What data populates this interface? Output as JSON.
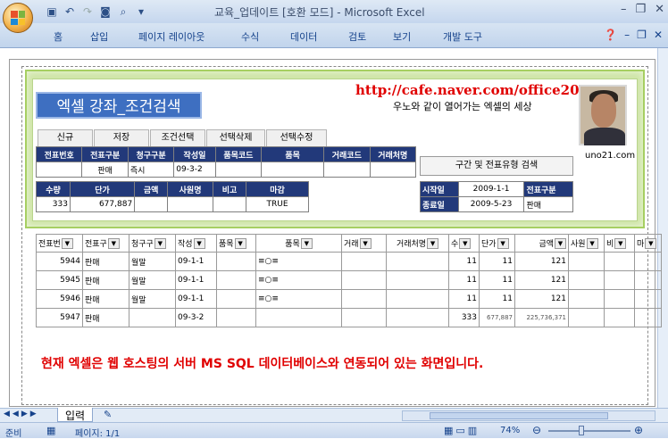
{
  "window": {
    "title": "교육_업데이트 [호환 모드] - Microsoft Excel"
  },
  "ribbon": {
    "tabs": [
      "홈",
      "삽입",
      "페이지 레이아웃",
      "수식",
      "데이터",
      "검토",
      "보기",
      "개발 도구"
    ]
  },
  "form": {
    "title": "엑셀 강좌_조건검색",
    "url": "http://cafe.naver.com/office2080",
    "slogan": "우노와 같이 열어가는 엑셀의 세상",
    "email": "uno21.com",
    "buttons": [
      "신규",
      "저장",
      "조건선택",
      "선택삭제",
      "선택수정"
    ],
    "row1_headers": [
      "전표번호",
      "전표구분",
      "청구구분",
      "작성일",
      "품목코드",
      "품목",
      "거래코드",
      "거래처명"
    ],
    "row1_values": [
      "",
      "판매",
      "즉시",
      "09-3-2",
      "",
      "",
      "",
      ""
    ],
    "row2_headers": [
      "수량",
      "단가",
      "금액",
      "사원명",
      "비고",
      "마감"
    ],
    "row2_values": [
      "333",
      "677,887",
      "",
      "",
      "",
      "TRUE"
    ],
    "search_label": "구간 및 전표유형 검색",
    "start_label": "시작일",
    "start_value": "2009-1-1",
    "end_label": "종료일",
    "end_value": "2009-5-23",
    "type_label": "전표구분",
    "type_value": "판매"
  },
  "table": {
    "headers": [
      "전표번",
      "전표구",
      "청구구",
      "작성",
      "품목",
      "품목",
      "거래",
      "거래처명",
      "수",
      "단가",
      "금액",
      "사원",
      "비",
      "마"
    ],
    "rows": [
      [
        "5944",
        "판매",
        "월말",
        "09-1-1",
        "",
        "≡○≡",
        "",
        "",
        "11",
        "11",
        "121",
        "",
        "",
        ""
      ],
      [
        "5945",
        "판매",
        "월말",
        "09-1-1",
        "",
        "≡○≡",
        "",
        "",
        "11",
        "11",
        "121",
        "",
        "",
        ""
      ],
      [
        "5946",
        "판매",
        "월말",
        "09-1-1",
        "",
        "≡○≡",
        "",
        "",
        "11",
        "11",
        "121",
        "",
        "",
        ""
      ],
      [
        "5947",
        "판매",
        "",
        "09-3-2",
        "",
        "",
        "",
        "",
        "333",
        "677,887",
        "225,736,371",
        "",
        "",
        ""
      ]
    ]
  },
  "notice": "현재 엑셀은 웹 호스팅의 서버 MS SQL 데이터베이스와 연동되어 있는 화면입니다.",
  "sheet_tab": "입력",
  "status": {
    "ready": "준비",
    "page": "페이지: 1/1",
    "zoom": "74%"
  }
}
